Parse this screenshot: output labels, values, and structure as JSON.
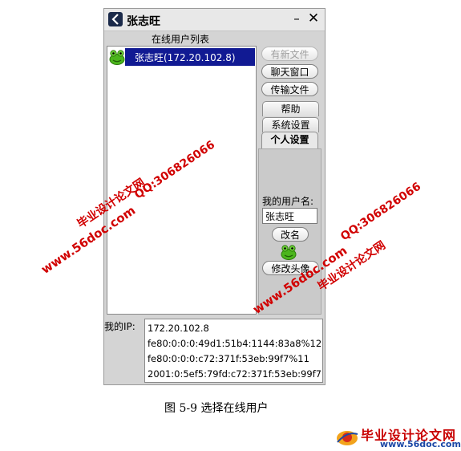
{
  "window": {
    "title": "张志旺",
    "minimize_glyph": "–",
    "close_glyph": "✕"
  },
  "list": {
    "header": "在线用户列表",
    "items": [
      {
        "label": "张志旺(172.20.102.8)",
        "selected": true,
        "icon": "frog-icon"
      }
    ]
  },
  "buttons": {
    "new_file": "有新文件",
    "chat_window": "聊天窗口",
    "transfer_file": "传输文件"
  },
  "tabs": {
    "help": "帮助",
    "system_settings": "系统设置",
    "personal_settings": "个人设置"
  },
  "personal": {
    "username_label": "我的用户名:",
    "username_value": "张志旺",
    "rename_button": "改名",
    "change_avatar_button": "修改头像"
  },
  "ip": {
    "label": "我的IP:",
    "lines": [
      "172.20.102.8",
      "fe80:0:0:0:49d1:51b4:1144:83a8%12",
      "fe80:0:0:0:c72:371f:53eb:99f7%11",
      "2001:0:5ef5:79fd:c72:371f:53eb:99f7"
    ]
  },
  "caption": "图  5-9 选择在线用户",
  "watermarks": {
    "site_name": "毕业设计论文网",
    "url": "www.56doc.com",
    "qq": "QQ:306826066"
  },
  "footer_logo": {
    "name": "毕业设计论文网",
    "url": "www.56doc.com"
  },
  "colors": {
    "selection": "#111a93",
    "watermark": "#d10000"
  }
}
